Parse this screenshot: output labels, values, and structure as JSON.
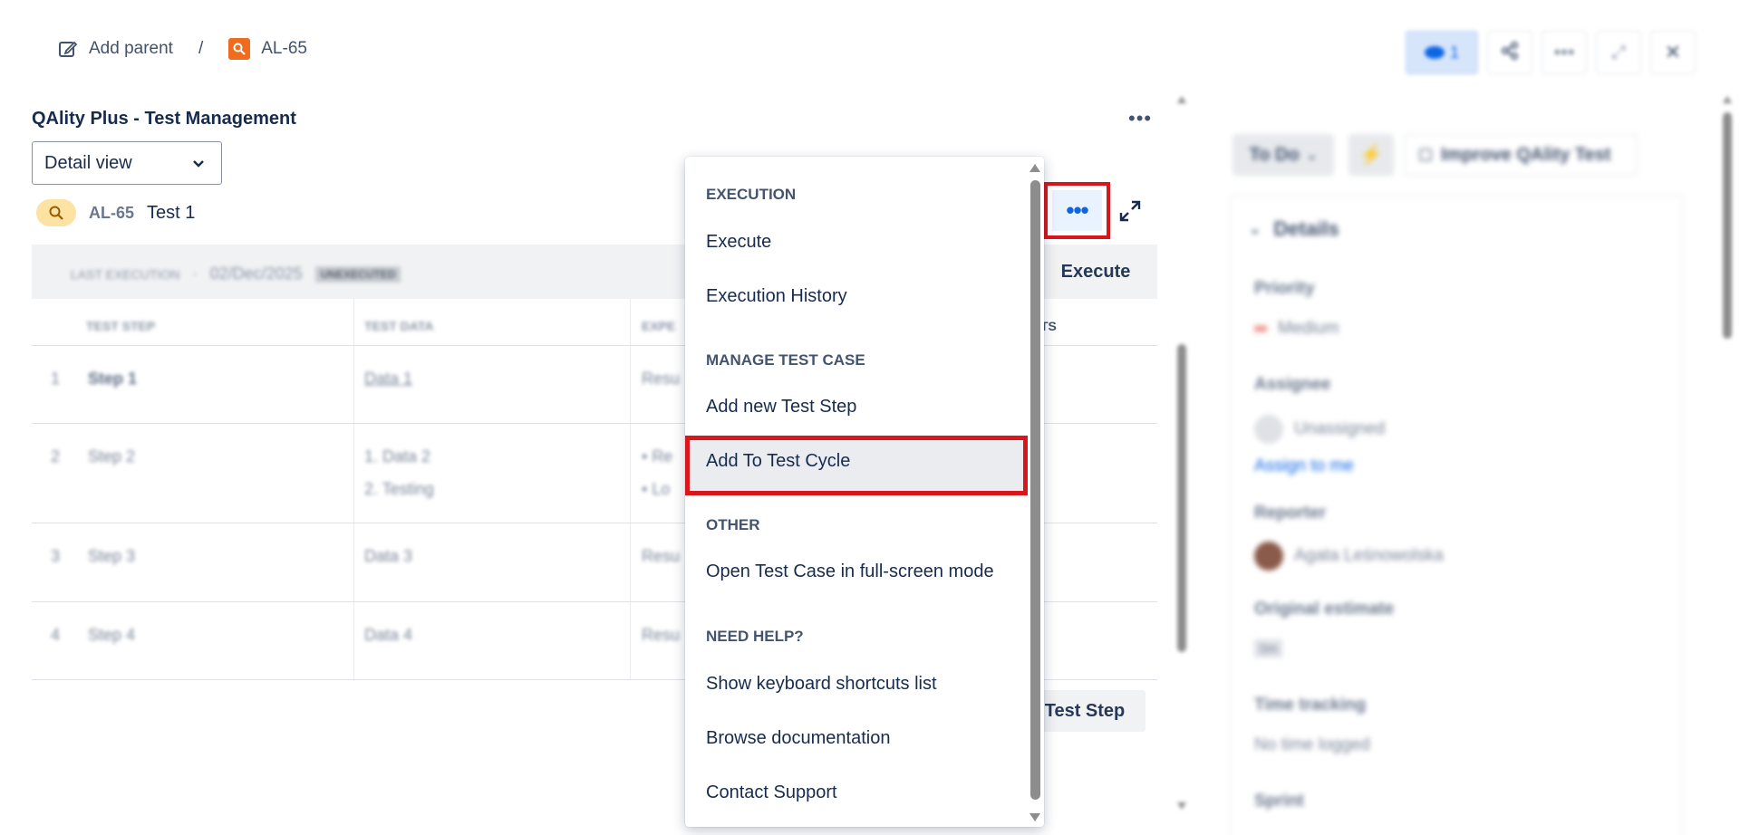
{
  "breadcrumb": {
    "add_parent": "Add parent",
    "separator": "/",
    "issue_key": "AL-65"
  },
  "header_actions": {
    "watch_count": "1"
  },
  "panel": {
    "title": "QAlity Plus - Test Management",
    "view_select": "Detail view",
    "test_case_key": "AL-65",
    "test_case_name": "Test 1"
  },
  "execution_bar": {
    "label": "LAST EXECUTION",
    "dot": "·",
    "date": "02/Dec/2025",
    "status": "UNEXECUTED",
    "execute_button": "Execute"
  },
  "table": {
    "headers": [
      "TEST STEP",
      "TEST DATA",
      "EXPE",
      "TS"
    ],
    "rows": [
      {
        "num": "1",
        "step": "Step 1",
        "data": [
          "Data 1"
        ],
        "result": [
          "Resu"
        ]
      },
      {
        "num": "2",
        "step": "Step 2",
        "data": [
          "1. Data 2",
          "2. Testing"
        ],
        "result": [
          "Re",
          "Lo"
        ]
      },
      {
        "num": "3",
        "step": "Step 3",
        "data": [
          "Data 3"
        ],
        "result": [
          "Resu"
        ]
      },
      {
        "num": "4",
        "step": "Step 4",
        "data": [
          "Data 4"
        ],
        "result": [
          "Resu"
        ]
      }
    ],
    "add_step_button": "Test Step"
  },
  "menu": {
    "sections": [
      {
        "heading": "EXECUTION",
        "items": [
          "Execute",
          "Execution History"
        ]
      },
      {
        "heading": "MANAGE TEST CASE",
        "items": [
          "Add new Test Step",
          "Add To Test Cycle"
        ]
      },
      {
        "heading": "OTHER",
        "items": [
          "Open Test Case in full-screen mode"
        ]
      },
      {
        "heading": "NEED HELP?",
        "items": [
          "Show keyboard shortcuts list",
          "Browse documentation",
          "Contact Support"
        ]
      }
    ],
    "highlighted_item": "Add To Test Cycle"
  },
  "sidebar": {
    "status": "To Do",
    "improve_button": "Improve QAlity Test",
    "details_title": "Details",
    "priority_label": "Priority",
    "priority_value": "Medium",
    "assignee_label": "Assignee",
    "assignee_value": "Unassigned",
    "assign_to_me": "Assign to me",
    "reporter_label": "Reporter",
    "reporter_value": "Agata Leśnowolska",
    "estimate_label": "Original estimate",
    "estimate_value": "0m",
    "time_tracking_label": "Time tracking",
    "time_tracking_value": "No time logged",
    "sprint_label": "Sprint"
  },
  "colors": {
    "highlight_border": "#d9161c",
    "brand_orange": "#ef6c1e",
    "link_blue": "#0c66e4"
  }
}
